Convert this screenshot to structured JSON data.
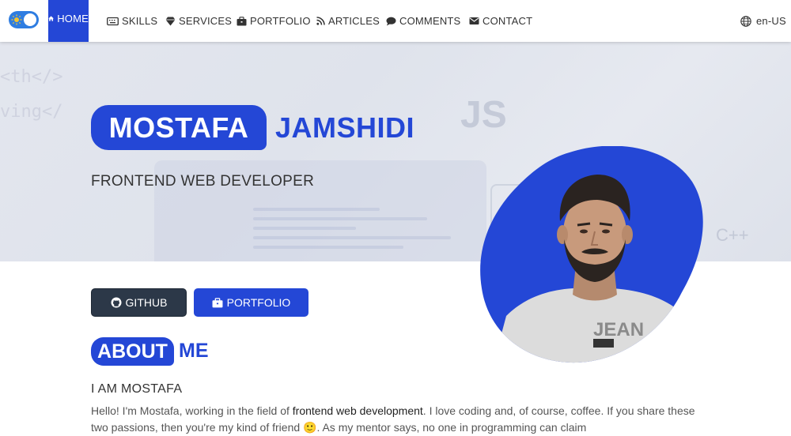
{
  "nav": {
    "theme_toggle": "light-dark-toggle",
    "items": [
      {
        "label": "HOME",
        "icon": "home-icon"
      },
      {
        "label": "SKILLS",
        "icon": "keyboard-icon"
      },
      {
        "label": "SERVICES",
        "icon": "gem-icon"
      },
      {
        "label": "PORTFOLIO",
        "icon": "briefcase-icon"
      },
      {
        "label": "ARTICLES",
        "icon": "rss-icon"
      },
      {
        "label": "COMMENTS",
        "icon": "comment-icon"
      },
      {
        "label": "CONTACT",
        "icon": "envelope-icon"
      }
    ],
    "language": "en-US"
  },
  "hero": {
    "first_name": "MOSTAFA",
    "last_name": "JAMSHIDI",
    "role": "FRONTEND WEB DEVELOPER"
  },
  "buttons": {
    "github": "GITHUB",
    "portfolio": "PORTFOLIO"
  },
  "about": {
    "title_highlight": "ABOUT",
    "title_rest": "ME",
    "subheading": "I AM MOSTAFA",
    "para_part1": "Hello! I'm Mostafa, working in the field of ",
    "para_strong": "frontend web development",
    "para_part2": ". I love coding and, of course, coffee. If you share these two passions, then you're my kind of friend 🙂. As my mentor says, no one in programming can claim"
  },
  "colors": {
    "accent": "#2447d6",
    "dark_button": "#2c3848"
  }
}
